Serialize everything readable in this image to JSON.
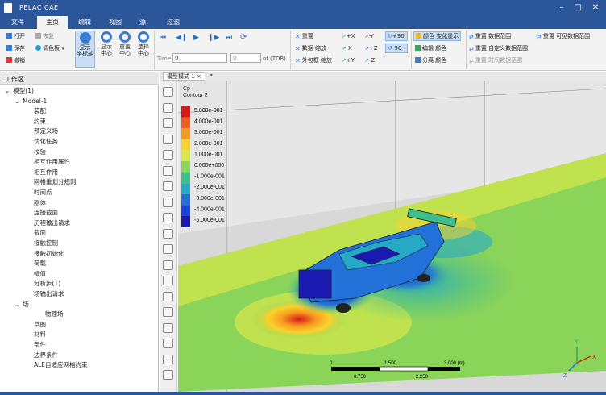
{
  "app": {
    "title": "PELAC CAE"
  },
  "window_controls": [
    "–",
    "□",
    "✕"
  ],
  "tabs": [
    "文件",
    "主页",
    "编辑",
    "视图",
    "源",
    "过滤"
  ],
  "active_tab": 1,
  "ribbon": {
    "file_group": {
      "open": "打开",
      "restore": "恢复",
      "save": "保存",
      "palette": "调色板",
      "undo": "撤销"
    },
    "big_buttons": [
      {
        "label1": "显示",
        "label2": "坐标轴",
        "color": "#3a7bd5"
      },
      {
        "label1": "显示",
        "label2": "中心",
        "color": "#3a7bd5"
      },
      {
        "label1": "重置",
        "label2": "中心",
        "color": "#3a7bd5"
      },
      {
        "label1": "选择",
        "label2": "中心",
        "color": "#d83b3b"
      }
    ],
    "playback": {
      "glyphs": [
        "⏮",
        "◀❙",
        "▶",
        "❙▶",
        "⏭",
        "⟳"
      ],
      "time_label": "Time:",
      "time_value": "0",
      "step_value": "0",
      "of_label": "of (TDB)"
    },
    "view_group": {
      "reset": "重置",
      "data_zoom": "数据 缩放",
      "outline_zoom": "外包框 缩放",
      "axes": [
        "+X",
        "-X",
        "+Y",
        "-Y",
        "+Z",
        "-Z"
      ],
      "rotate": [
        "+90",
        "-90"
      ]
    },
    "color_group": {
      "color_change": "颜色 变化显示",
      "edit_color": "编辑 颜色",
      "separate_color": "分离 颜色"
    },
    "range_group": {
      "reset_range": "重置 数据范围",
      "reset_custom_range": "重置 自定义数据范围",
      "reset_time_range": "重置 时间数据范围",
      "reset_visible_range": "重置 可见数据范围"
    }
  },
  "left_panel": {
    "title": "工作区",
    "tree": [
      {
        "text": "模型(1)",
        "level": 0,
        "arrow": "⌄"
      },
      {
        "text": "Model-1",
        "level": 1,
        "arrow": "⌄"
      },
      {
        "text": "装配",
        "level": 2
      },
      {
        "text": "约束",
        "level": 2
      },
      {
        "text": "预定义场",
        "level": 2
      },
      {
        "text": "优化任务",
        "level": 2
      },
      {
        "text": "校验",
        "level": 2
      },
      {
        "text": "相互作用属性",
        "level": 2
      },
      {
        "text": "相互作用",
        "level": 2
      },
      {
        "text": "网格重划分规则",
        "level": 2
      },
      {
        "text": "时间点",
        "level": 2
      },
      {
        "text": "刚体",
        "level": 2
      },
      {
        "text": "连接截面",
        "level": 2
      },
      {
        "text": "历程输出请求",
        "level": 2
      },
      {
        "text": "截面",
        "level": 2
      },
      {
        "text": "接触控制",
        "level": 2
      },
      {
        "text": "接触初始化",
        "level": 2
      },
      {
        "text": "荷载",
        "level": 2
      },
      {
        "text": "幅值",
        "level": 2
      },
      {
        "text": "分析步(1)",
        "level": 2
      },
      {
        "text": "场输出请求",
        "level": 2
      },
      {
        "text": "场",
        "level": 1,
        "arrow": "⌄"
      },
      {
        "text": "物理场",
        "level": 3
      },
      {
        "text": "草图",
        "level": 2
      },
      {
        "text": "材料",
        "level": 2
      },
      {
        "text": "部件",
        "level": 2
      },
      {
        "text": "边界条件",
        "level": 2
      },
      {
        "text": "ALE自适应网格约束",
        "level": 2
      }
    ]
  },
  "view_tab": {
    "label": "模型模式 1",
    "close": "×"
  },
  "legend": {
    "title1": "Cp",
    "title2": "Contour 2",
    "labels": [
      "5.000e-001",
      "4.000e-001",
      "3.000e-001",
      "2.000e-001",
      "1.000e-001",
      "0.000e+000",
      "-1.000e-001",
      "-2.000e-001",
      "-3.000e-001",
      "-4.000e-001",
      "-5.000e-001"
    ],
    "colors": [
      "#d7191c",
      "#f05a1e",
      "#f79a20",
      "#fcd22c",
      "#d9e84a",
      "#8ad45a",
      "#3dbf8a",
      "#26a8c8",
      "#2171d9",
      "#1a46e0",
      "#1a1ab0"
    ]
  },
  "scale_bar": {
    "ticks_top": [
      "0",
      "1.500",
      "3.000 (m)"
    ],
    "ticks_bottom": [
      "0.750",
      "2.250"
    ]
  },
  "axes": {
    "x": "X",
    "y": "Y",
    "z": "Z"
  },
  "colors": {
    "title_bar": "#2b579a",
    "ribbon_bg": "#f3f3f3",
    "selected_btn": "#c9def5"
  }
}
